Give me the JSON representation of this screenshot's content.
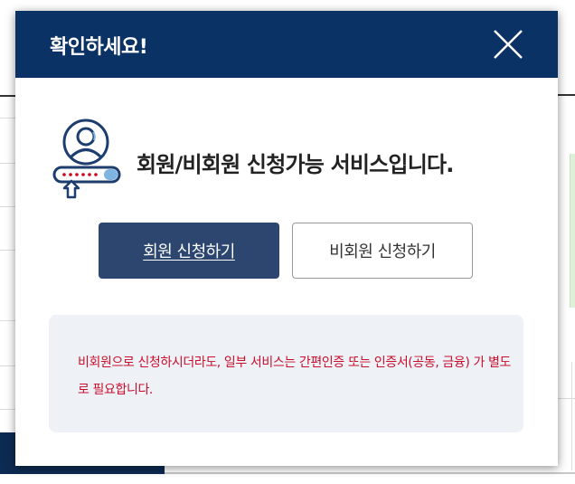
{
  "modal": {
    "title": "확인하세요!",
    "close_icon": "close-icon",
    "intro_icon": "user-id-card-icon",
    "message": "회원/비회원 신청가능 서비스입니다.",
    "buttons": {
      "member": "회원 신청하기",
      "nonmember": "비회원 신청하기"
    },
    "notice": "비회원으로 신청하시더라도, 일부 서비스는 간편인증 또는 인증서(공동, 금융) 가 별도로 필요합니다."
  },
  "colors": {
    "header": "#0a3264",
    "member_button": "#2c4670",
    "notice_text": "#c8102e",
    "notice_bg": "#eef1f5"
  }
}
